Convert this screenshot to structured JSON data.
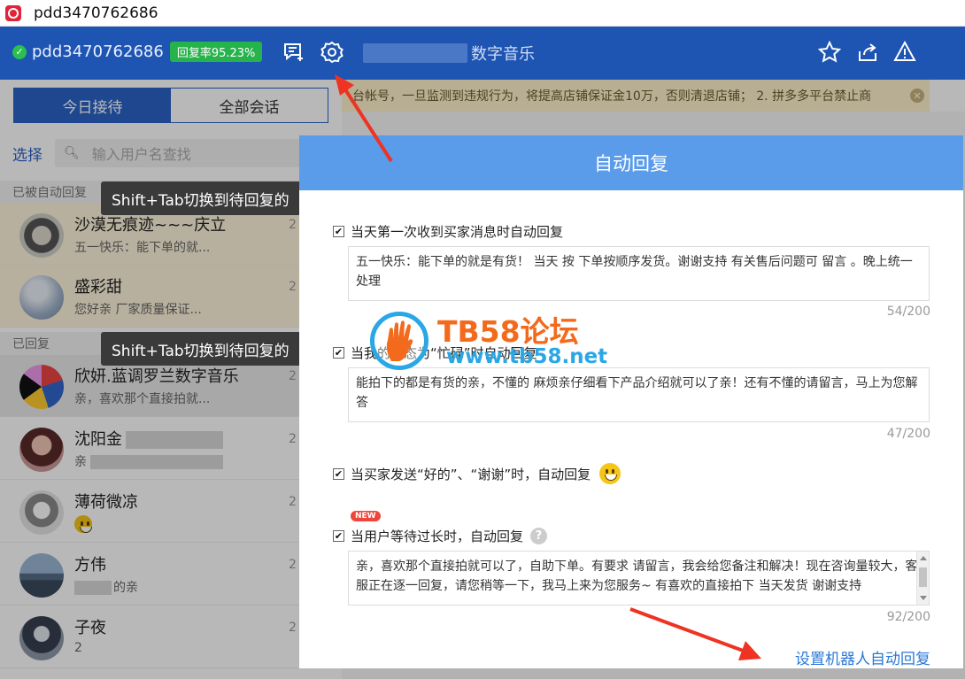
{
  "window": {
    "title": "pdd3470762686"
  },
  "header": {
    "account_name": "pdd3470762686",
    "reply_rate": "回复率95.23%",
    "conversation_title_suffix": "数字音乐"
  },
  "left": {
    "tabs": [
      "今日接待",
      "全部会话"
    ],
    "select_label": "选择",
    "search_placeholder": "输入用户名查找",
    "section_auto": "已被自动回复",
    "section_replied": "已回复",
    "tooltip": "Shift+Tab切换到待回复的",
    "conversations": [
      {
        "name": "沙漠无痕迹~~~庆立",
        "msg": "五一快乐：能下单的就...",
        "time": "2"
      },
      {
        "name": "盛彩甜",
        "msg": "您好亲 厂家质量保证...",
        "time": "2"
      },
      {
        "name": "欣妍.蓝调罗兰数字音乐",
        "msg": "亲，喜欢那个直接拍就...",
        "time": "2"
      },
      {
        "name": "沈阳金",
        "msg": "亲",
        "time": "2"
      },
      {
        "name": "薄荷微凉",
        "msg": "",
        "time": "2"
      },
      {
        "name": "方伟",
        "msg": "的亲",
        "time": "2"
      },
      {
        "name": "子夜",
        "msg": "2",
        "time": "2"
      }
    ]
  },
  "notice": {
    "text": "台帐号，一旦监测到违规行为，将提高店铺保证金10万，否则清退店铺； 2. 拼多多平台禁止商"
  },
  "modal": {
    "title": "自动回复",
    "options": [
      {
        "label": "当天第一次收到买家消息时自动回复",
        "checked": true,
        "text": "五一快乐：能下单的就是有货！ 当天 按 下单按顺序发货。谢谢支持  有关售后问题可 留言 。晚上统一处理",
        "count": "54/200"
      },
      {
        "label": "当我的状态为“忙碌”时自动回复",
        "checked": true,
        "text": "能拍下的都是有货的亲，不懂的 麻烦亲仔细看下产品介绍就可以了亲！还有不懂的请留言，马上为您解答",
        "count": "47/200"
      },
      {
        "label": "当买家发送“好的”、“谢谢”时，自动回复",
        "checked": true
      },
      {
        "label": "当用户等待过长时，自动回复",
        "checked": true,
        "badge": "NEW",
        "text": "亲，喜欢那个直接拍就可以了，自助下单。有要求 请留言，我会给您备注和解决！现在咨询量较大，客服正在逐一回复，请您稍等一下，我马上来为您服务~  有喜欢的直接拍下  当天发货 谢谢支持",
        "count": "92/200"
      }
    ],
    "robot_link": "设置机器人自动回复"
  },
  "watermark": {
    "line1": "TB58论坛",
    "line2": "www.tb58.net"
  },
  "colors": {
    "header": "#1f55b2",
    "modal_head": "#5a9bea",
    "link": "#2b78d6",
    "badge": "#f0453a",
    "rate": "#27b34b"
  }
}
